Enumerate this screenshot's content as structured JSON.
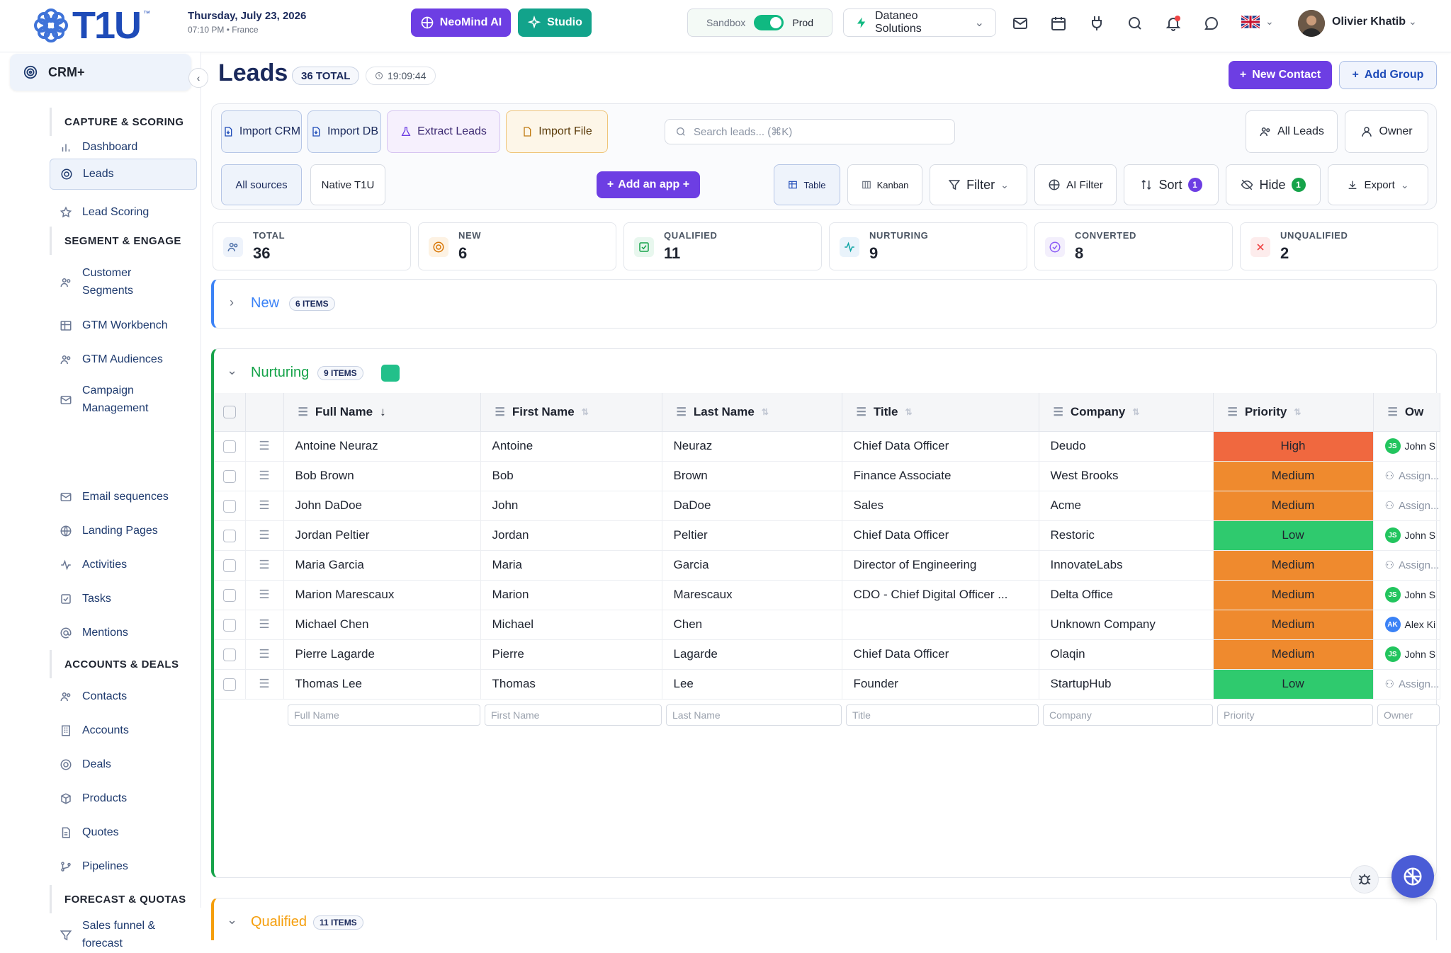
{
  "header": {
    "logo_text": "T1U",
    "logo_tm": "™",
    "date_line": "Thursday, July 23, 2026",
    "time_line": "07:10 PM • France",
    "neomind_label": "NeoMind AI",
    "studio_label": "Studio",
    "env_sandbox": "Sandbox",
    "env_prod": "Prod",
    "company_name": "Dataneo Solutions",
    "user_name": "Olivier Khatib",
    "colors": {
      "neomind": "#6d3ee3",
      "studio": "#12a38b",
      "toggle_on": "#10b981",
      "logo": "#1e4bb8"
    }
  },
  "sidebar": {
    "module": "CRM+",
    "sections": [
      {
        "label": "CAPTURE & SCORING"
      },
      {
        "label": "SEGMENT & ENGAGE"
      },
      {
        "label": "ACCOUNTS & DEALS"
      },
      {
        "label": "FORECAST & QUOTAS"
      }
    ],
    "items": [
      {
        "label": "Dashboard",
        "icon": "bar-chart-icon"
      },
      {
        "label": "Leads",
        "icon": "target-icon",
        "active": true
      },
      {
        "label": "Lead Scoring",
        "icon": "star-icon"
      },
      {
        "label": "Customer Segments",
        "icon": "users-icon"
      },
      {
        "label": "GTM Workbench",
        "icon": "table-icon"
      },
      {
        "label": "GTM Audiences",
        "icon": "users-icon"
      },
      {
        "label": "Campaign Management",
        "icon": "mail-icon"
      },
      {
        "label": "Email sequences",
        "icon": "mail-icon"
      },
      {
        "label": "Landing Pages",
        "icon": "globe-icon"
      },
      {
        "label": "Activities",
        "icon": "activity-icon"
      },
      {
        "label": "Tasks",
        "icon": "check-square-icon"
      },
      {
        "label": "Mentions",
        "icon": "at-sign-icon"
      },
      {
        "label": "Contacts",
        "icon": "users-icon"
      },
      {
        "label": "Accounts",
        "icon": "building-icon"
      },
      {
        "label": "Deals",
        "icon": "target-icon"
      },
      {
        "label": "Products",
        "icon": "box-icon"
      },
      {
        "label": "Quotes",
        "icon": "file-icon"
      },
      {
        "label": "Pipelines",
        "icon": "git-branch-icon"
      },
      {
        "label": "Sales funnel & forecast",
        "icon": "funnel-icon"
      }
    ]
  },
  "page": {
    "title": "Leads",
    "total_badge": "36 TOTAL",
    "clock": "19:09:44",
    "new_contact": "New Contact",
    "add_group": "Add Group"
  },
  "toolbar": {
    "import_crm": "Import CRM",
    "import_db": "Import DB",
    "extract_leads": "Extract Leads",
    "import_file": "Import File",
    "search_placeholder": "Search leads... (⌘K)",
    "all_leads": "All Leads",
    "owner": "Owner",
    "all_sources": "All sources",
    "native": "Native T1U",
    "add_app": "Add an app +",
    "table_view": "Table",
    "kanban_view": "Kanban",
    "filter": "Filter",
    "ai_filter": "AI Filter",
    "sort": "Sort",
    "sort_count": "1",
    "hide": "Hide",
    "hide_count": "1",
    "export": "Export"
  },
  "stats": [
    {
      "label": "TOTAL",
      "value": "36",
      "icon": "users-icon",
      "color": "#eef3fb"
    },
    {
      "label": "NEW",
      "value": "6",
      "icon": "target-icon",
      "color": "#fdf2e3"
    },
    {
      "label": "QUALIFIED",
      "value": "11",
      "icon": "check-square-icon",
      "color": "#e8f7ee"
    },
    {
      "label": "NURTURING",
      "value": "9",
      "icon": "activity-icon",
      "color": "#e9f3fb"
    },
    {
      "label": "CONVERTED",
      "value": "8",
      "icon": "check-circle-icon",
      "color": "#f3effc"
    },
    {
      "label": "UNQUALIFIED",
      "value": "2",
      "icon": "x-icon",
      "color": "#fdecec"
    }
  ],
  "groups": {
    "new": {
      "title": "New",
      "count": "6 ITEMS",
      "color": "#3b82f6"
    },
    "nurturing": {
      "title": "Nurturing",
      "count": "9 ITEMS",
      "color": "#16a34a"
    },
    "qualified": {
      "title": "Qualified",
      "count": "11 ITEMS",
      "color": "#f59e0b"
    }
  },
  "table": {
    "columns": [
      "Full Name",
      "First Name",
      "Last Name",
      "Title",
      "Company",
      "Priority",
      "Ow"
    ],
    "filter_placeholders": [
      "Full Name",
      "First Name",
      "Last Name",
      "Title",
      "Company",
      "Priority",
      "Owner"
    ],
    "priority_colors": {
      "High": "#f0683f",
      "Medium": "#ef8a2e",
      "Low": "#2fca6e"
    },
    "rows": [
      {
        "full": "Antoine Neuraz",
        "first": "Antoine",
        "last": "Neuraz",
        "title": "Chief Data Officer",
        "company": "Deudo",
        "priority": "High",
        "owner": "John S",
        "owner_initials": "JS"
      },
      {
        "full": "Bob Brown",
        "first": "Bob",
        "last": "Brown",
        "title": "Finance Associate",
        "company": "West Brooks",
        "priority": "Medium",
        "owner": "Assign...",
        "owner_initials": ""
      },
      {
        "full": "John DaDoe",
        "first": "John",
        "last": "DaDoe",
        "title": "Sales",
        "company": "Acme",
        "priority": "Medium",
        "owner": "Assign...",
        "owner_initials": ""
      },
      {
        "full": "Jordan Peltier",
        "first": "Jordan",
        "last": "Peltier",
        "title": "Chief Data Officer",
        "company": "Restoric",
        "priority": "Low",
        "owner": "John S",
        "owner_initials": "JS"
      },
      {
        "full": "Maria Garcia",
        "first": "Maria",
        "last": "Garcia",
        "title": "Director of Engineering",
        "company": "InnovateLabs",
        "priority": "Medium",
        "owner": "Assign...",
        "owner_initials": ""
      },
      {
        "full": "Marion Marescaux",
        "first": "Marion",
        "last": "Marescaux",
        "title": "CDO - Chief Digital Officer ...",
        "company": "Delta Office",
        "priority": "Medium",
        "owner": "John S",
        "owner_initials": "JS"
      },
      {
        "full": "Michael Chen",
        "first": "Michael",
        "last": "Chen",
        "title": "",
        "company": "Unknown Company",
        "priority": "Medium",
        "owner": "Alex Ki",
        "owner_initials": "AK"
      },
      {
        "full": "Pierre Lagarde",
        "first": "Pierre",
        "last": "Lagarde",
        "title": "Chief Data Officer",
        "company": "Olaqin",
        "priority": "Medium",
        "owner": "John S",
        "owner_initials": "JS"
      },
      {
        "full": "Thomas Lee",
        "first": "Thomas",
        "last": "Lee",
        "title": "Founder",
        "company": "StartupHub",
        "priority": "Low",
        "owner": "Assign...",
        "owner_initials": ""
      }
    ]
  }
}
